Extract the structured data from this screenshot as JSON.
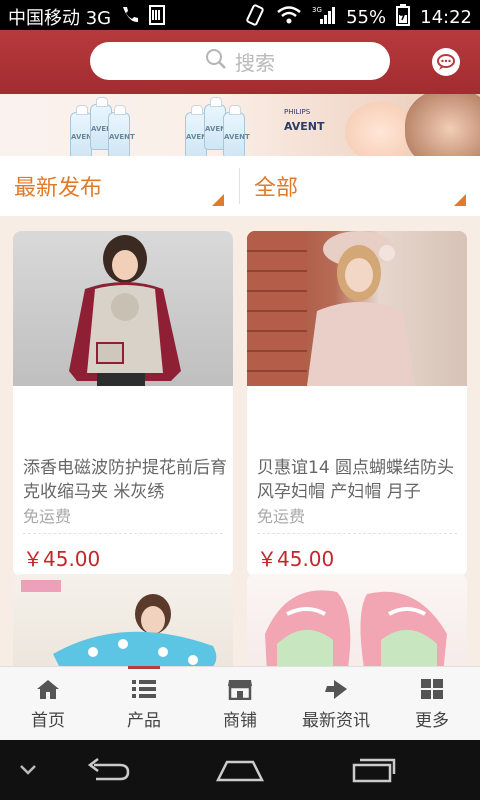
{
  "status_bar": {
    "carrier": "中国移动 3G",
    "network": "3G",
    "battery": "55%",
    "time": "14:22"
  },
  "header": {
    "search_placeholder": "搜索"
  },
  "banner": {
    "brand": "AVENT",
    "brand_small": "PHILIPS"
  },
  "filters": {
    "left": "最新发布",
    "right": "全部"
  },
  "products": [
    {
      "title": "添香电磁波防护提花前后育克收缩马夹 米灰绣",
      "shipping": "免运费",
      "price": "￥45.00"
    },
    {
      "title": "贝惠谊14 圆点蝴蝶结防头风孕妇帽 产妇帽 月子",
      "shipping": "免运费",
      "price": "￥45.00"
    },
    {
      "title": "",
      "shipping": "",
      "price": ""
    },
    {
      "title": "",
      "shipping": "",
      "price": ""
    }
  ],
  "tabbar": {
    "items": [
      {
        "label": "首页",
        "icon": "home-icon"
      },
      {
        "label": "产品",
        "icon": "list-icon"
      },
      {
        "label": "商铺",
        "icon": "store-icon"
      },
      {
        "label": "最新资讯",
        "icon": "news-icon"
      },
      {
        "label": "更多",
        "icon": "more-icon"
      }
    ],
    "active_index": 1
  },
  "colors": {
    "accent_red": "#b73a3d",
    "filter_orange": "#e07b2b",
    "price_red": "#c3272b"
  }
}
